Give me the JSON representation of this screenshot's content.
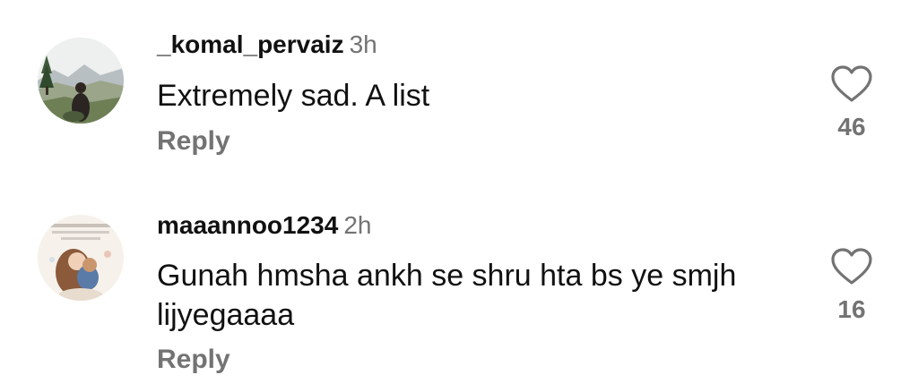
{
  "comments": [
    {
      "username": "_komal_pervaiz",
      "timestamp": "3h",
      "text": "Extremely sad. A list",
      "reply_label": "Reply",
      "like_count": "46",
      "avatar_icon": "landscape-photo-avatar",
      "heart_icon": "heart-outline-icon"
    },
    {
      "username": "maaannoo1234",
      "timestamp": "2h",
      "text": "Gunah hmsha ankh se shru hta bs ye smjh lijyegaaaa",
      "reply_label": "Reply",
      "like_count": "16",
      "avatar_icon": "illustration-avatar",
      "heart_icon": "heart-outline-icon"
    }
  ],
  "colors": {
    "primary_text": "#111111",
    "secondary_text": "#737373",
    "background": "#ffffff"
  }
}
